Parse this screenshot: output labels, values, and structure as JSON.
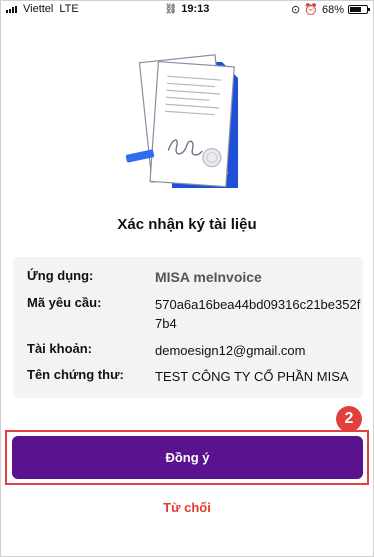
{
  "status_bar": {
    "carrier": "Viettel",
    "network": "LTE",
    "time": "19:13",
    "battery": "68%",
    "battery_level": 0.68
  },
  "dialog": {
    "title": "Xác nhận ký tài liệu",
    "fields": [
      {
        "label": "Ứng dụng:",
        "value": "MISA meInvoice"
      },
      {
        "label": "Mã yêu cầu:",
        "value": "570a6a16bea44bd09316c21be352f7b4"
      },
      {
        "label": "Tài khoản:",
        "value": "demoesign12@gmail.com"
      },
      {
        "label": "Tên chứng thư:",
        "value": "TEST CÔNG TY CỔ PHẦN MISA"
      }
    ],
    "agree_label": "Đồng ý",
    "decline_label": "Từ chối"
  },
  "annotation": {
    "step_number": "2",
    "color": "#e0413f"
  },
  "colors": {
    "primary": "#5b128f",
    "decline": "#e23b2f",
    "card_bg": "#f3f3f6",
    "illustration_blue": "#1f4fd6"
  }
}
